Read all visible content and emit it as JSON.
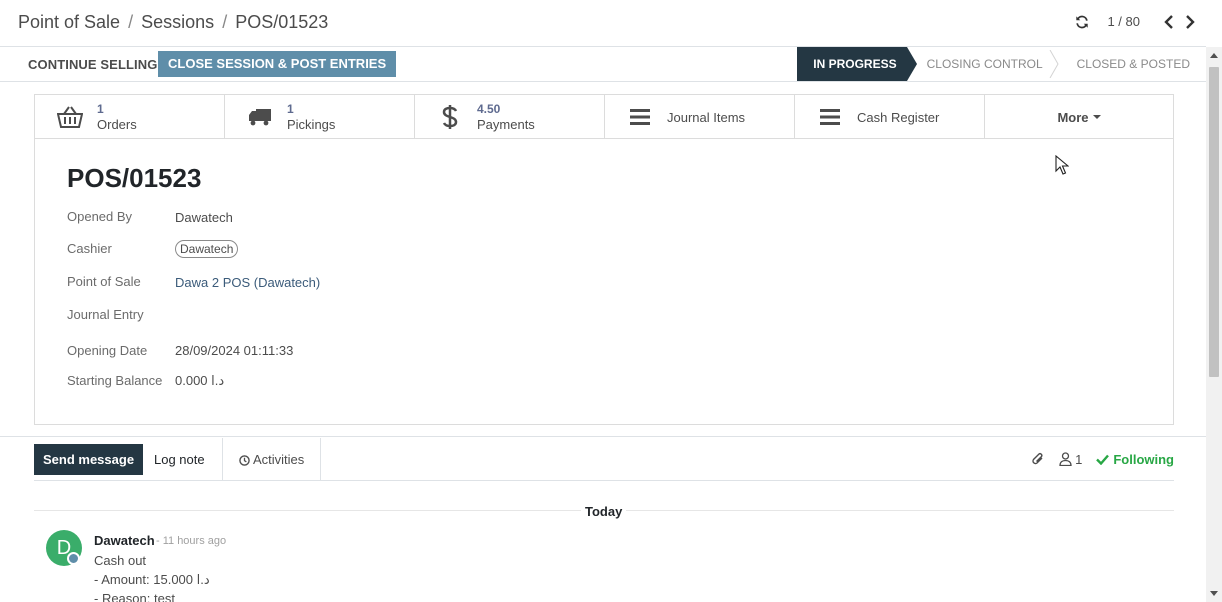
{
  "breadcrumb": {
    "items": [
      "Point of Sale",
      "Sessions",
      "POS/01523"
    ],
    "separator": "/"
  },
  "pager": {
    "counter": "1 / 80"
  },
  "statusbar": {
    "continue_label": "CONTINUE SELLING",
    "close_label": "CLOSE SESSION & POST ENTRIES",
    "stages": [
      "IN PROGRESS",
      "CLOSING CONTROL",
      "CLOSED & POSTED"
    ]
  },
  "smart_buttons": {
    "orders": {
      "value": "1",
      "label": "Orders"
    },
    "pickings": {
      "value": "1",
      "label": "Pickings"
    },
    "payments": {
      "value": "4.50",
      "label": "Payments"
    },
    "journal_items": {
      "label": "Journal Items"
    },
    "cash_register": {
      "label": "Cash Register"
    },
    "more": {
      "label": "More"
    }
  },
  "form": {
    "title": "POS/01523",
    "opened_by": {
      "label": "Opened By",
      "value": "Dawatech"
    },
    "cashier": {
      "label": "Cashier",
      "value": "Dawatech"
    },
    "point_of_sale": {
      "label": "Point of Sale",
      "value": "Dawa 2 POS (Dawatech)"
    },
    "journal_entry": {
      "label": "Journal Entry",
      "value": ""
    },
    "opening_date": {
      "label": "Opening Date",
      "value": "28/09/2024 01:11:33"
    },
    "starting_balance": {
      "label": "Starting Balance",
      "value": "0.000 د.ا"
    }
  },
  "chatter": {
    "send_message": "Send message",
    "log_note": "Log note",
    "activities": "Activities",
    "followers_count": "1",
    "following": "Following",
    "today": "Today",
    "message": {
      "avatar_letter": "D",
      "author": "Dawatech",
      "time": "- 11 hours ago",
      "lines": [
        "Cash out",
        "- Amount: 15.000 د.ا",
        "- Reason: test"
      ]
    }
  },
  "colors": {
    "primary": "#5f8ea9",
    "dark": "#243743",
    "following": "#28a745",
    "avatar": "#3aad6a"
  }
}
